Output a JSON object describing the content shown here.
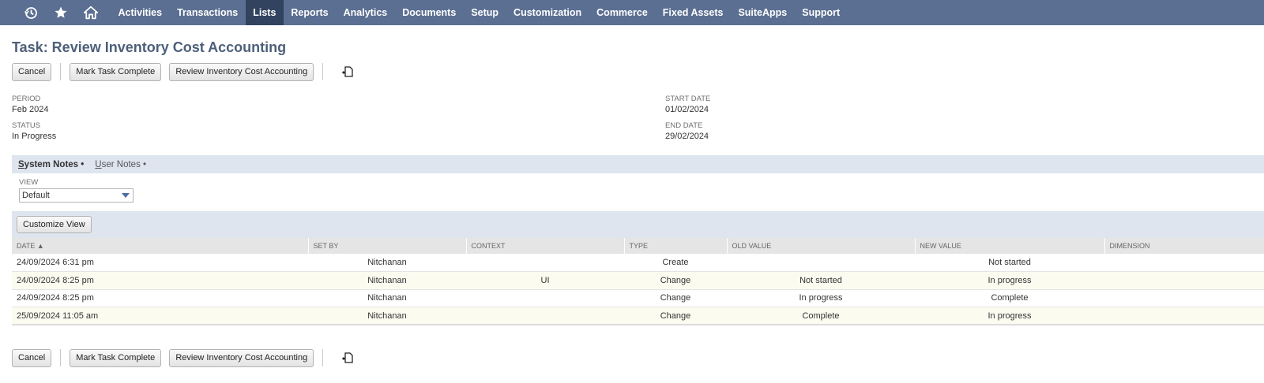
{
  "nav": {
    "icons": [
      "recent-icon",
      "star-icon",
      "home-icon"
    ],
    "items": [
      {
        "label": "Activities",
        "active": false
      },
      {
        "label": "Transactions",
        "active": false
      },
      {
        "label": "Lists",
        "active": true
      },
      {
        "label": "Reports",
        "active": false
      },
      {
        "label": "Analytics",
        "active": false
      },
      {
        "label": "Documents",
        "active": false
      },
      {
        "label": "Setup",
        "active": false
      },
      {
        "label": "Customization",
        "active": false
      },
      {
        "label": "Commerce",
        "active": false
      },
      {
        "label": "Fixed Assets",
        "active": false
      },
      {
        "label": "SuiteApps",
        "active": false
      },
      {
        "label": "Support",
        "active": false
      }
    ],
    "bg_color": "#5b6f92",
    "active_color": "#32435f"
  },
  "page": {
    "title": "Task: Review Inventory Cost Accounting"
  },
  "buttons": {
    "cancel": "Cancel",
    "mark_complete": "Mark Task Complete",
    "review": "Review Inventory Cost Accounting"
  },
  "fields": {
    "period": {
      "label": "PERIOD",
      "value": "Feb 2024"
    },
    "status": {
      "label": "STATUS",
      "value": "In Progress"
    },
    "start_date": {
      "label": "START DATE",
      "value": "01/02/2024"
    },
    "end_date": {
      "label": "END DATE",
      "value": "29/02/2024"
    }
  },
  "subtabs": {
    "system_notes": {
      "first": "S",
      "rest": "ystem Notes",
      "bullet": "•"
    },
    "user_notes": {
      "first": "U",
      "rest": "ser Notes",
      "bullet": "•"
    }
  },
  "view": {
    "label": "VIEW",
    "selected": "Default",
    "customize_label": "Customize View"
  },
  "table": {
    "headers": {
      "date": "DATE ▲",
      "set_by": "SET BY",
      "context": "CONTEXT",
      "type": "TYPE",
      "old_value": "OLD VALUE",
      "new_value": "NEW VALUE",
      "dimension": "DIMENSION"
    },
    "rows": [
      {
        "date": "24/09/2024 6:31 pm",
        "set_by": "Nitchanan",
        "context": "",
        "type": "Create",
        "old_value": "",
        "new_value": "Not started",
        "dimension": ""
      },
      {
        "date": "24/09/2024 8:25 pm",
        "set_by": "Nitchanan",
        "context": "UI",
        "type": "Change",
        "old_value": "Not started",
        "new_value": "In progress",
        "dimension": ""
      },
      {
        "date": "24/09/2024 8:25 pm",
        "set_by": "Nitchanan",
        "context": "",
        "type": "Change",
        "old_value": "In progress",
        "new_value": "Complete",
        "dimension": ""
      },
      {
        "date": "25/09/2024 11:05 am",
        "set_by": "Nitchanan",
        "context": "",
        "type": "Change",
        "old_value": "Complete",
        "new_value": "In progress",
        "dimension": ""
      }
    ]
  }
}
